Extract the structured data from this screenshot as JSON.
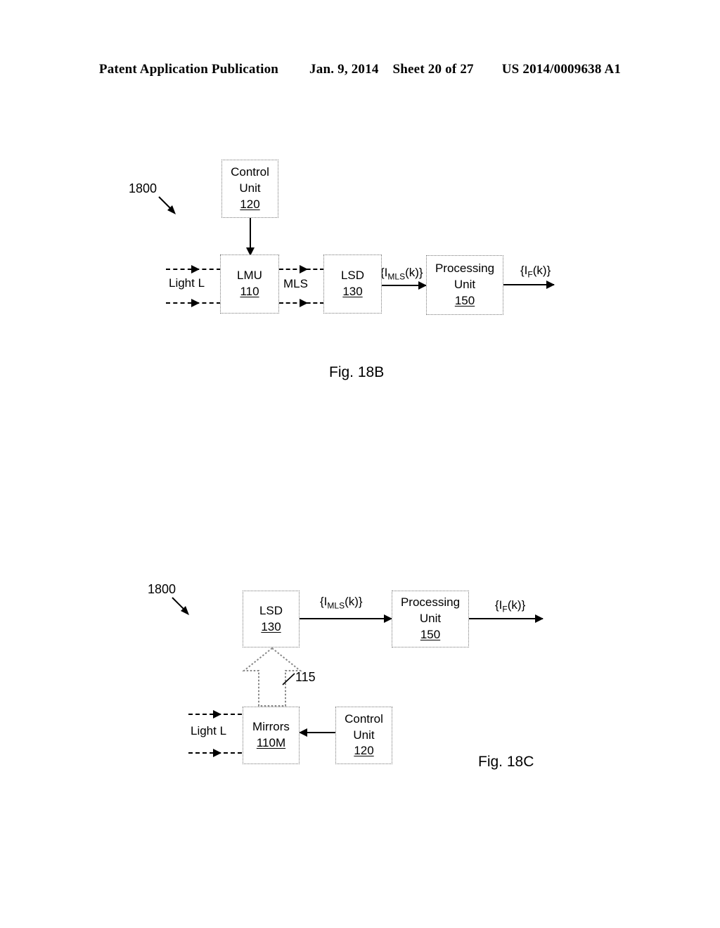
{
  "header": {
    "publication": "Patent Application Publication",
    "date": "Jan. 9, 2014",
    "sheet": "Sheet 20 of 27",
    "number": "US 2014/0009638 A1"
  },
  "figures": [
    {
      "id": "fig-18b",
      "caption": "Fig. 18B",
      "system_ref": "1800",
      "boxes": [
        {
          "name": "control-unit",
          "line1": "Control",
          "line2": "Unit",
          "num": "120"
        },
        {
          "name": "lmu",
          "line1": "LMU",
          "line2": "",
          "num": "110"
        },
        {
          "name": "lsd",
          "line1": "LSD",
          "line2": "",
          "num": "130"
        },
        {
          "name": "processing-unit",
          "line1": "Processing",
          "line2": "Unit",
          "num": "150"
        }
      ],
      "labels": {
        "light": "Light L",
        "mls": "MLS",
        "signal_imls": "{I",
        "signal_imls_sub": "MLS",
        "signal_imls_tail": "(k)}",
        "signal_if": "{I",
        "signal_if_sub": "F",
        "signal_if_tail": "(k)}"
      }
    },
    {
      "id": "fig-18c",
      "caption": "Fig. 18C",
      "system_ref": "1800",
      "boxes": [
        {
          "name": "lsd",
          "line1": "LSD",
          "line2": "",
          "num": "130"
        },
        {
          "name": "processing-unit",
          "line1": "Processing",
          "line2": "Unit",
          "num": "150"
        },
        {
          "name": "mirrors",
          "line1": "Mirrors",
          "line2": "",
          "num": "110M"
        },
        {
          "name": "control-unit",
          "line1": "Control",
          "line2": "Unit",
          "num": "120"
        }
      ],
      "labels": {
        "light": "Light L",
        "beam_ref": "115",
        "signal_imls": "{I",
        "signal_imls_sub": "MLS",
        "signal_imls_tail": "(k)}",
        "signal_if": "{I",
        "signal_if_sub": "F",
        "signal_if_tail": "(k)}"
      }
    }
  ],
  "colors": {
    "ink": "#000000",
    "box_border": "#777777",
    "background": "#ffffff"
  }
}
